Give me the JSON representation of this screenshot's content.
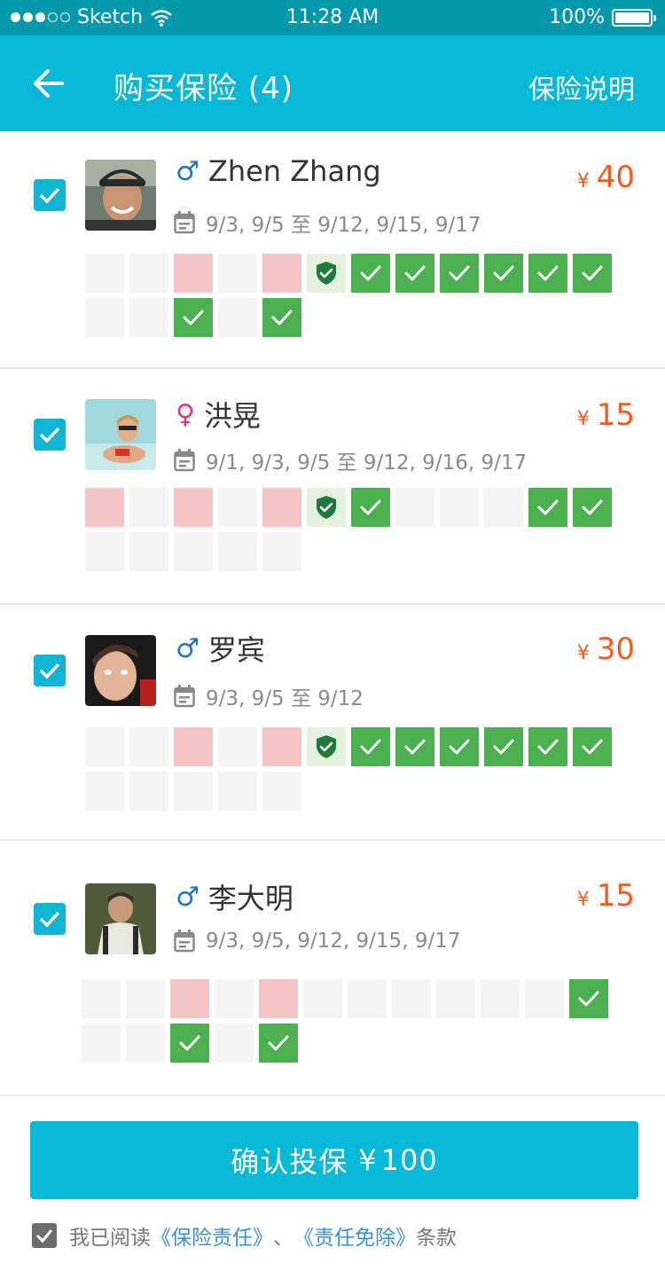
{
  "status_bar": {
    "carrier": "Sketch",
    "time": "11:28 AM",
    "battery": "100%"
  },
  "header": {
    "title": "购买保险 (4)",
    "right_link": "保险说明"
  },
  "passengers": [
    {
      "name": "Zhen Zhang",
      "gender_icon": "male-icon",
      "gender_symbol": "♂",
      "currency": "¥",
      "price": "40",
      "dates": "9/3, 9/5 至 9/12, 9/15, 9/17",
      "cells": [
        "empty",
        "empty",
        "pink",
        "empty",
        "pink",
        "shield",
        "check",
        "check",
        "check",
        "check",
        "check",
        "check",
        "empty",
        "empty",
        "check",
        "empty",
        "check"
      ]
    },
    {
      "name": "洪晃",
      "gender_icon": "female-icon",
      "gender_symbol": "♀",
      "currency": "¥",
      "price": "15",
      "dates": "9/1, 9/3, 9/5 至 9/12, 9/16, 9/17",
      "cells": [
        "pink",
        "empty",
        "pink",
        "empty",
        "pink",
        "shield",
        "check",
        "empty",
        "empty",
        "empty",
        "check",
        "check",
        "empty",
        "empty",
        "empty",
        "empty",
        "empty"
      ]
    },
    {
      "name": "罗宾",
      "gender_icon": "male-icon",
      "gender_symbol": "♂",
      "currency": "¥",
      "price": "30",
      "dates": "9/3, 9/5 至 9/12",
      "cells": [
        "empty",
        "empty",
        "pink",
        "empty",
        "pink",
        "shield",
        "check",
        "check",
        "check",
        "check",
        "check",
        "check",
        "empty",
        "empty",
        "empty",
        "empty",
        "empty"
      ]
    },
    {
      "name": "李大明",
      "gender_icon": "male-icon",
      "gender_symbol": "♂",
      "currency": "¥",
      "price": "15",
      "dates": "9/3, 9/5, 9/12, 9/15, 9/17",
      "cells": [
        "empty",
        "empty",
        "pink",
        "empty",
        "pink",
        "empty",
        "empty",
        "empty",
        "empty",
        "empty",
        "empty",
        "check",
        "empty",
        "empty",
        "check",
        "empty",
        "check"
      ]
    }
  ],
  "footer": {
    "confirm_label": "确认投保",
    "confirm_currency": "¥",
    "confirm_amount": "100",
    "agree_prefix": "我已阅读",
    "link_liability": "《保险责任》",
    "separator": "、",
    "link_exemption": "《责任免除》",
    "agree_suffix": "条款"
  },
  "colors": {
    "header_bg": "#07b9d6",
    "status_bg": "#0498ad",
    "price": "#f25b1f",
    "check_green": "#4caf50",
    "unavailable_pink": "#f5c5c5",
    "link": "#3a8fd9"
  }
}
